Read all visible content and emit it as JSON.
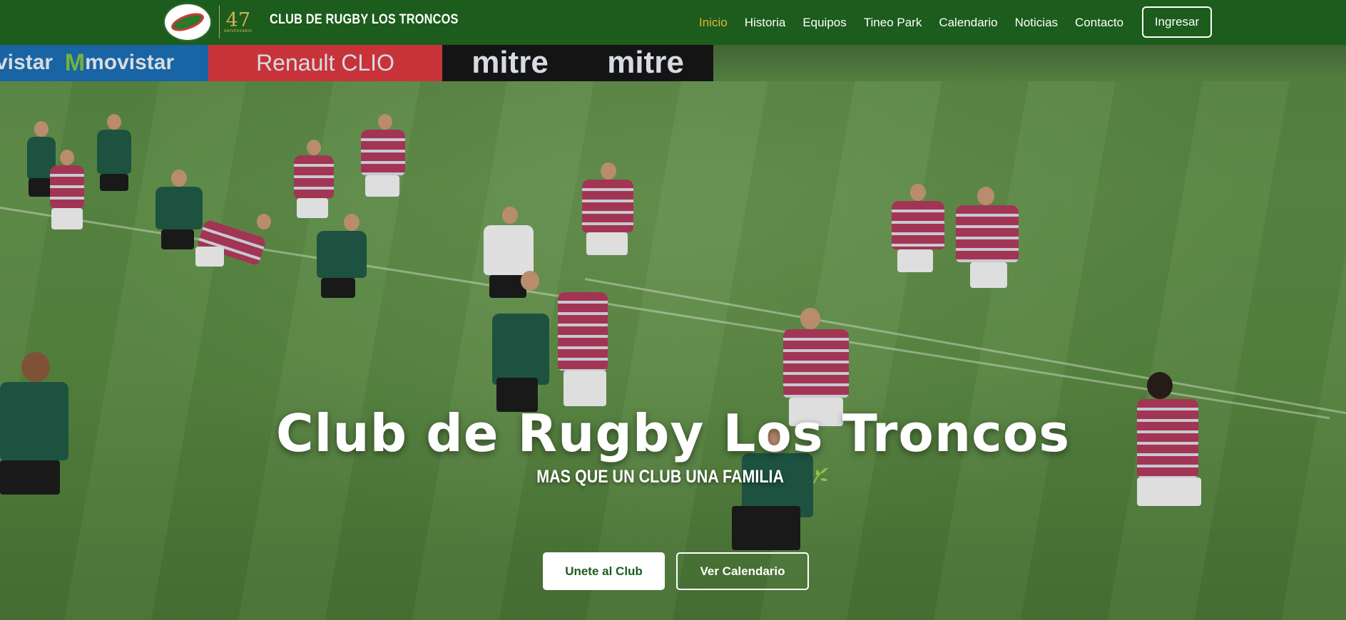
{
  "header": {
    "logo_alt": "Club de Rugby Los Troncos",
    "anniversary_number": "47",
    "anniversary_label": "ANIVERSARIO",
    "brand": "CLUB DE RUGBY LOS TRONCOS",
    "nav": [
      {
        "label": "Inicio",
        "active": true
      },
      {
        "label": "Historia",
        "active": false
      },
      {
        "label": "Equipos",
        "active": false
      },
      {
        "label": "Tineo Park",
        "active": false
      },
      {
        "label": "Calendario",
        "active": false
      },
      {
        "label": "Noticias",
        "active": false
      },
      {
        "label": "Contacto",
        "active": false
      }
    ],
    "login_label": "Ingresar"
  },
  "hero": {
    "ads": [
      "movistar",
      "Renault CLIO",
      "mitre",
      "mitre"
    ],
    "title": "Club de Rugby Los Troncos",
    "subtitle": "MAS QUE UN CLUB UNA FAMILIA",
    "subtitle_icon": "leaf-icon",
    "primary_cta": "Unete al Club",
    "secondary_cta": "Ver Calendario"
  },
  "colors": {
    "nav_bg": "#1c5c1c",
    "active_link": "#e5b43a",
    "cta_text": "#1c5c1c",
    "home_jersey": "#1f5a45",
    "away_jersey": "#b03a5b"
  }
}
